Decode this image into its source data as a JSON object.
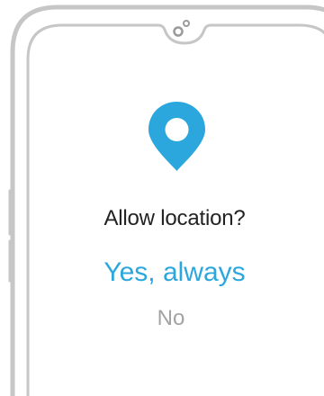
{
  "dialog": {
    "prompt": "Allow location?",
    "yes_label": "Yes, always",
    "no_label": "No"
  },
  "icons": {
    "pin": "location-pin-icon",
    "camera": "front-camera-icon"
  },
  "colors": {
    "accent": "#2ba7dd",
    "text": "#222222",
    "muted": "#a3a3a3",
    "frame": "#c6c6c6"
  }
}
